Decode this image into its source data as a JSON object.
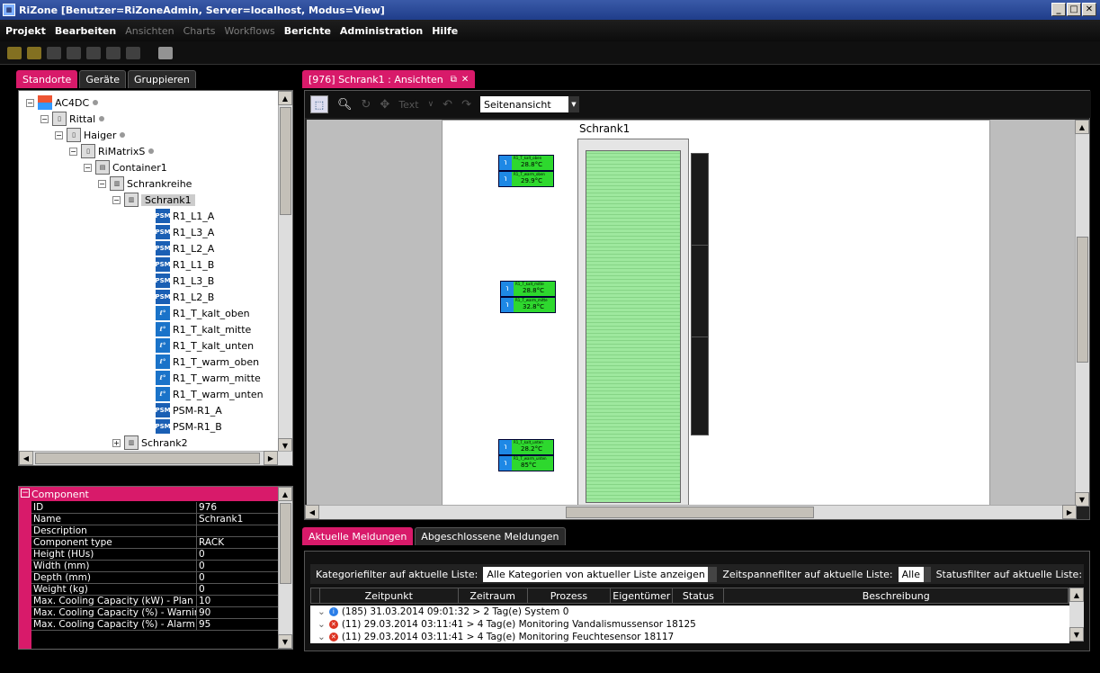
{
  "window": {
    "title": "RiZone [Benutzer=RiZoneAdmin, Server=localhost, Modus=View]"
  },
  "menu": [
    {
      "label": "Projekt",
      "enabled": true
    },
    {
      "label": "Bearbeiten",
      "enabled": true
    },
    {
      "label": "Ansichten",
      "enabled": false
    },
    {
      "label": "Charts",
      "enabled": false
    },
    {
      "label": "Workflows",
      "enabled": false
    },
    {
      "label": "Berichte",
      "enabled": true
    },
    {
      "label": "Administration",
      "enabled": true
    },
    {
      "label": "Hilfe",
      "enabled": true
    }
  ],
  "left_tabs": [
    "Standorte",
    "Geräte",
    "Gruppieren"
  ],
  "tree": [
    {
      "label": "AC4DC",
      "icon": "building-icon",
      "exp": "⊟"
    },
    {
      "label": "Rittal",
      "icon": "rack-icon",
      "exp": "⊟"
    },
    {
      "label": "Haiger",
      "icon": "rack-icon",
      "exp": "⊟"
    },
    {
      "label": "RiMatrixS",
      "icon": "rack-icon",
      "exp": "⊟"
    },
    {
      "label": "Container1",
      "icon": "container-icon",
      "exp": "⊟"
    },
    {
      "label": "Schrankreihe",
      "icon": "rack-row-icon",
      "exp": "⊟"
    },
    {
      "label": "Schrank1",
      "icon": "rack-row-icon",
      "exp": "⊟"
    },
    {
      "label": "R1_L1_A",
      "icon": "psm-icon"
    },
    {
      "label": "R1_L3_A",
      "icon": "psm-icon"
    },
    {
      "label": "R1_L2_A",
      "icon": "psm-icon"
    },
    {
      "label": "R1_L1_B",
      "icon": "psm-icon"
    },
    {
      "label": "R1_L3_B",
      "icon": "psm-icon"
    },
    {
      "label": "R1_L2_B",
      "icon": "psm-icon"
    },
    {
      "label": "R1_T_kalt_oben",
      "icon": "temperature-icon"
    },
    {
      "label": "R1_T_kalt_mitte",
      "icon": "temperature-icon"
    },
    {
      "label": "R1_T_kalt_unten",
      "icon": "temperature-icon"
    },
    {
      "label": "R1_T_warm_oben",
      "icon": "temperature-icon"
    },
    {
      "label": "R1_T_warm_mitte",
      "icon": "temperature-icon"
    },
    {
      "label": "R1_T_warm_unten",
      "icon": "temperature-icon"
    },
    {
      "label": "PSM-R1_A",
      "icon": "psm-icon"
    },
    {
      "label": "PSM-R1_B",
      "icon": "psm-icon"
    },
    {
      "label": "Schrank2",
      "icon": "rack-row-icon",
      "exp": "⊞"
    }
  ],
  "component": {
    "header": "Component",
    "rows": [
      [
        "ID",
        "976"
      ],
      [
        "Name",
        "Schrank1"
      ],
      [
        "Description",
        ""
      ],
      [
        "Component type",
        "RACK"
      ],
      [
        "Height (HUs)",
        "0"
      ],
      [
        "Width (mm)",
        "0"
      ],
      [
        "Depth (mm)",
        "0"
      ],
      [
        "Weight (kg)",
        "0"
      ],
      [
        "Max. Cooling Capacity (kW) - Plan",
        "10"
      ],
      [
        "Max. Cooling Capacity (%) - Warning",
        "90"
      ],
      [
        "Max. Cooling Capacity (%) - Alarm",
        "95"
      ]
    ]
  },
  "doc_tab": {
    "label": "[976] Schrank1 : Ansichten"
  },
  "view": {
    "text_tool": "Text",
    "view_select": "Seitenansicht",
    "rack_title": "Schrank1",
    "sensors": [
      {
        "name": "R1_T_kalt_oben",
        "value": "28.8°C"
      },
      {
        "name": "R1_T_warm_oben",
        "value": "29.9°C"
      },
      {
        "name": "R1_T_kalt_mitte",
        "value": "28.8°C"
      },
      {
        "name": "R1_T_warm_mitte",
        "value": "32.8°C"
      },
      {
        "name": "R1_T_kalt_unten",
        "value": "28.2°C"
      },
      {
        "name": "R1_T_warm_unten",
        "value": "85°C"
      }
    ]
  },
  "msg_tabs": [
    "Aktuelle Meldungen",
    "Abgeschlossene Meldungen"
  ],
  "filters": {
    "category_label": "Kategoriefilter auf aktuelle Liste:",
    "category_value": "Alle Kategorien von aktueller Liste anzeigen",
    "time_label": "Zeitspannefilter auf aktuelle Liste:",
    "time_value": "Alle",
    "status_label": "Statusfilter auf aktuelle Liste:"
  },
  "msg_columns": [
    "Zeitpunkt",
    "Zeitraum",
    "Prozess",
    "Eigentümer",
    "Status",
    "Beschreibung"
  ],
  "messages": [
    {
      "icon": "info-icon",
      "text": "(185) 31.03.2014 09:01:32 > 2 Tag(e) System  0"
    },
    {
      "icon": "error-icon",
      "text": "(11) 29.03.2014 03:11:41 > 4 Tag(e) Monitoring Vandalismussensor 18125"
    },
    {
      "icon": "error-icon",
      "text": "(11) 29.03.2014 03:11:41 > 4 Tag(e) Monitoring Feuchtesensor 18117"
    }
  ],
  "colors": {
    "accent": "#d81a6a",
    "sensor_ok": "#2ed82e",
    "rack_fill": "#9ee89e"
  }
}
